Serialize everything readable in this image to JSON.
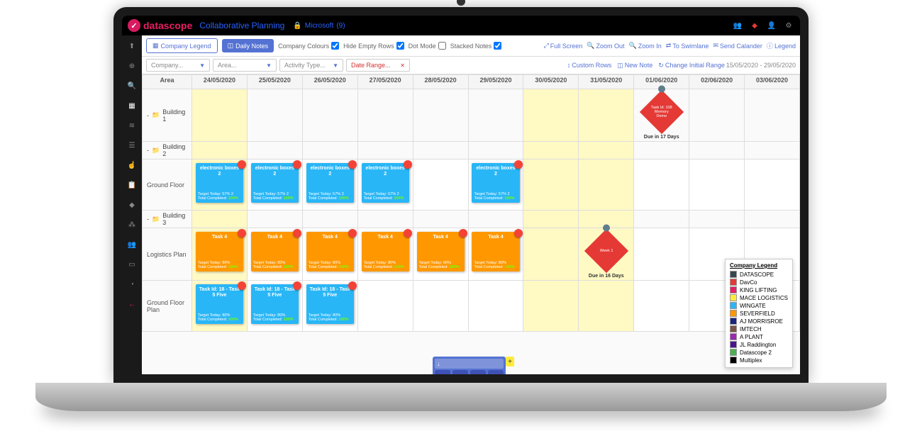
{
  "brand": "datascope",
  "page_title": "Collaborative Planning",
  "account": {
    "provider": "Microsoft",
    "count": "(9)"
  },
  "toolbar": {
    "company_legend": "Company Legend",
    "daily_notes": "Daily Notes",
    "company_colours": "Company Colours",
    "hide_empty_rows": "Hide Empty Rows",
    "dot_mode": "Dot Mode",
    "stacked_notes": "Stacked Notes",
    "full_screen": "Full Screen",
    "zoom_out": "Zoom Out",
    "zoom_in": "Zoom In",
    "to_swimlane": "To Swimlane",
    "send_calendar": "Send Calander",
    "legend": "Legend"
  },
  "filters": {
    "company": "Company...",
    "area": "Area...",
    "activity": "Activity Type...",
    "date_range": "Date Range...",
    "custom_rows": "Custom Rows",
    "new_note": "New Note",
    "change_initial_range": "Change Initial Range",
    "range_value": "15/05/2020 - 29/05/2020"
  },
  "headers": {
    "area": "Area",
    "dates": [
      "24/05/2020",
      "25/05/2020",
      "26/05/2020",
      "27/05/2020",
      "28/05/2020",
      "29/05/2020",
      "30/05/2020",
      "31/05/2020",
      "01/06/2020",
      "02/06/2020",
      "03/06/2020"
    ]
  },
  "rows": {
    "b1": "Building 1",
    "b2": "Building 2",
    "gf": "Ground Floor",
    "b3": "Building 3",
    "lp": "Logistics Plan",
    "gfp": "Ground Floor Plan"
  },
  "notes": {
    "electronic": {
      "title": "electronic boxes 2",
      "target": "Target Today: 57%",
      "completed": "Total Completed:",
      "completed_val": "100%",
      "count": "2"
    },
    "task4": {
      "title": "Task 4",
      "target": "Target Today: 80%",
      "completed": "Total Completed:",
      "completed_val": "100%"
    },
    "task5": {
      "title": "Task Id: 18 - Task 5 Five",
      "target": "Target Today: 80%",
      "completed": "Total Completed:",
      "completed_val": "100%"
    }
  },
  "markers": {
    "memory": {
      "line1": "Task Id: 108",
      "line2": "Memory",
      "line3": "Demo",
      "due": "Due in 17 Days"
    },
    "week": {
      "line1": "Week 1",
      "due": "Due in 16 Days"
    }
  },
  "legend": {
    "title": "Company Legend",
    "items": [
      {
        "name": "DATASCOPE",
        "color": "#37474f"
      },
      {
        "name": "DavCo",
        "color": "#e53935"
      },
      {
        "name": "KING LIFTING",
        "color": "#e91e63"
      },
      {
        "name": "MACE LOGISTICS",
        "color": "#ffeb3b"
      },
      {
        "name": "WINGATE",
        "color": "#29b6f6"
      },
      {
        "name": "SEVERFIELD",
        "color": "#ff9800"
      },
      {
        "name": "AJ MORRISROE",
        "color": "#1a237e"
      },
      {
        "name": "IMTECH",
        "color": "#795548"
      },
      {
        "name": "A PLANT",
        "color": "#9c27b0"
      },
      {
        "name": "JL Raddington",
        "color": "#4a148c"
      },
      {
        "name": "Datascope 2",
        "color": "#4caf50"
      },
      {
        "name": "Multiplex",
        "color": "#000000"
      }
    ]
  }
}
